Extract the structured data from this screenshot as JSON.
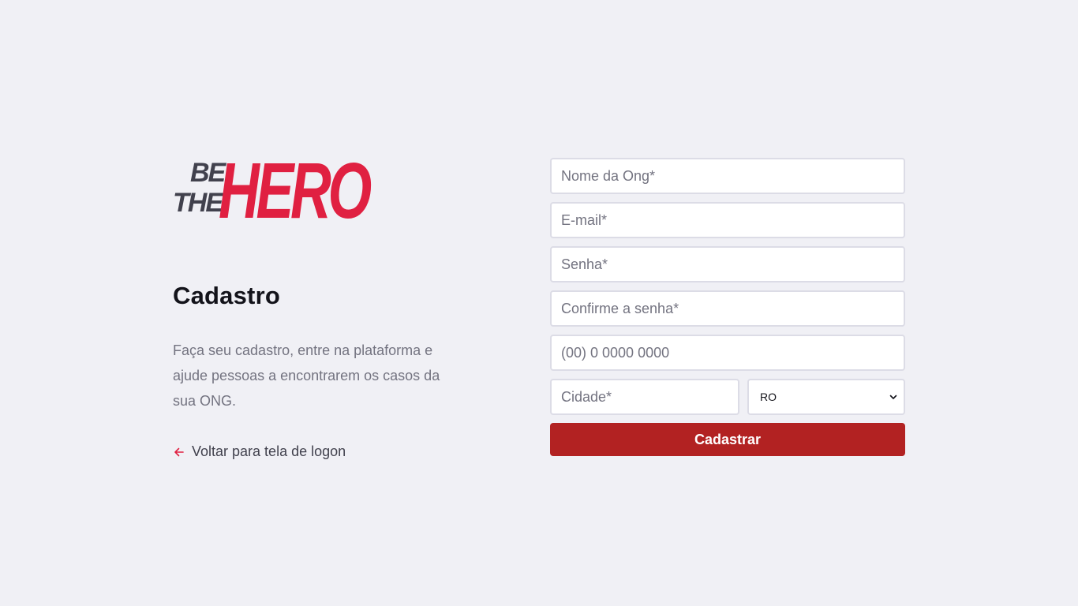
{
  "brand": {
    "logo_line1": "BE",
    "logo_line2": "THE",
    "logo_word": "HERO",
    "accent_color": "#e02041",
    "dark_color": "#41414d"
  },
  "intro": {
    "title": "Cadastro",
    "description": "Faça seu cadastro, entre na plataforma e ajude pessoas a encontrarem os casos da sua ONG.",
    "back_link": "Voltar para tela de logon"
  },
  "form": {
    "name_placeholder": "Nome da Ong*",
    "email_placeholder": "E-mail*",
    "password_placeholder": "Senha*",
    "confirm_password_placeholder": "Confirme a senha*",
    "phone_placeholder": "(00) 0 0000 0000",
    "city_placeholder": "Cidade*",
    "uf_selected": "RO",
    "submit_label": "Cadastrar",
    "submit_color": "#b22222"
  }
}
